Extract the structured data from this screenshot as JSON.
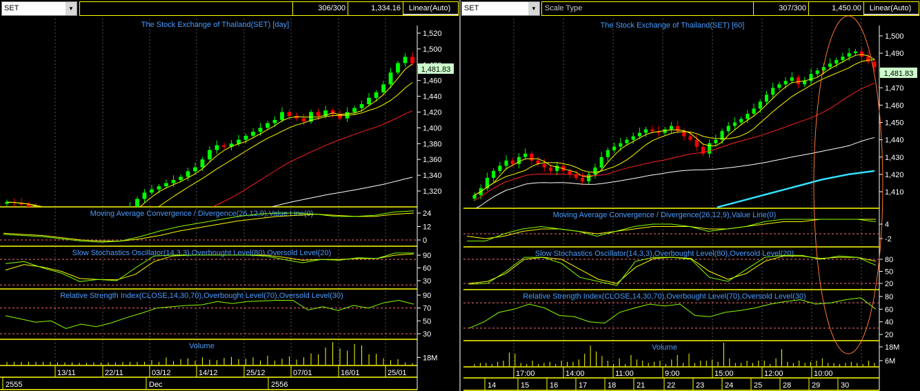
{
  "left": {
    "symbol": "SET",
    "count": "306/300",
    "value": "1,334.16",
    "scale": "Linear(Auto)",
    "scale_type_label": "",
    "title": "The Stock Exchange of Thailand(SET) [day]",
    "last_price": "1,481.83"
  },
  "right": {
    "symbol": "SET",
    "count": "307/300",
    "value": "1,450.00",
    "scale": "Linear(Auto)",
    "scale_type_label": "Scale Type",
    "title": "The Stock Exchange of Thailand(SET) [60]",
    "last_price": "1,481.83"
  },
  "colors": {
    "up": "#00ff00",
    "down": "#ff0000",
    "border": "#ffff00",
    "title": "#4a9cff",
    "ma_fast": "#ffff00",
    "ma_mid": "#ff2020",
    "ma_slow": "#ffffff",
    "ma_long": "#33e0ff",
    "level": "#ff7070",
    "annotation": "#ff7a30"
  },
  "chart_data": [
    {
      "type": "candlestick",
      "title": "The Stock Exchange of Thailand(SET) [day]",
      "ylim": [
        1310,
        1530
      ],
      "yticks": [
        "1,520",
        "1,500",
        "1,480",
        "1,460",
        "1,440",
        "1,420",
        "1,400",
        "1,380",
        "1,360",
        "1,340",
        "1,320"
      ],
      "xticks": [
        "13/11",
        "22/11",
        "03/12",
        "14/12",
        "25/12",
        "07/01",
        "16/01",
        "25/01"
      ],
      "periods": [
        "2555",
        "Dec",
        "2556"
      ],
      "close": [
        1306,
        1305,
        1303,
        1300,
        1295,
        1290,
        1285,
        1282,
        1280,
        1276,
        1272,
        1270,
        1268,
        1272,
        1278,
        1285,
        1292,
        1300,
        1310,
        1318,
        1322,
        1326,
        1330,
        1334,
        1338,
        1345,
        1350,
        1360,
        1372,
        1378,
        1376,
        1380,
        1385,
        1390,
        1395,
        1400,
        1406,
        1410,
        1420,
        1415,
        1412,
        1408,
        1420,
        1415,
        1422,
        1418,
        1412,
        1420,
        1425,
        1430,
        1438,
        1445,
        1455,
        1470,
        1482,
        1490,
        1481.83
      ],
      "volume": [
        8,
        8,
        8,
        8,
        8,
        8,
        8,
        7,
        7,
        7,
        6,
        6,
        7,
        7,
        7,
        7,
        8,
        8,
        8,
        8,
        12,
        8,
        18,
        10,
        14,
        16,
        11,
        18,
        13,
        12,
        17,
        19,
        14,
        15,
        18,
        11,
        22,
        11,
        15,
        20,
        13,
        18,
        27,
        25,
        40,
        52,
        38,
        33,
        48,
        45,
        25,
        26,
        16,
        12,
        14,
        7,
        5
      ],
      "volume_label": "Volume",
      "volume_ticks": [
        "18M"
      ],
      "macd": {
        "title": "Moving Average Convergence / Divergence(26,12,9),Value Line(0)",
        "ticks": [
          "24",
          "12",
          "0"
        ],
        "line": [
          5,
          4,
          3,
          1,
          -1,
          -2,
          -1,
          3,
          8,
          12,
          15,
          18,
          21,
          23,
          24,
          24,
          23,
          21,
          21,
          22,
          25,
          26
        ],
        "signal": [
          6,
          5,
          4,
          2,
          0,
          -1,
          -1,
          1,
          4,
          8,
          11,
          14,
          17,
          19,
          21,
          22,
          23,
          22,
          21,
          21,
          23,
          24
        ]
      },
      "stochastic": {
        "title": "Slow Stochastics Oscillator(14,3,3),Overbought Level(80),Oversold Level(20)",
        "ticks": [
          "90",
          "60",
          "30"
        ],
        "k": [
          70,
          75,
          60,
          48,
          28,
          33,
          30,
          60,
          88,
          90,
          90,
          90,
          90,
          90,
          88,
          80,
          72,
          80,
          78,
          84,
          82,
          95,
          95
        ],
        "d": [
          55,
          68,
          62,
          52,
          35,
          33,
          32,
          45,
          75,
          88,
          90,
          90,
          90,
          90,
          90,
          85,
          78,
          80,
          80,
          82,
          82,
          90,
          93
        ]
      },
      "rsi": {
        "title": "Relative Strength Index(CLOSE,14,30,70),Overbought Level(70),Oversold Level(30)",
        "ticks": [
          "90",
          "70",
          "50",
          "30"
        ],
        "values": [
          58,
          53,
          48,
          50,
          38,
          45,
          41,
          47,
          55,
          62,
          70,
          72,
          74,
          75,
          80,
          77,
          80,
          81,
          82,
          82,
          67,
          72,
          66,
          74,
          70,
          78,
          82,
          76
        ]
      }
    },
    {
      "type": "candlestick",
      "title": "The Stock Exchange of Thailand(SET) [60]",
      "ylim": [
        1403,
        1510
      ],
      "yticks": [
        "1,500",
        "1,490",
        "1,480",
        "1,470",
        "1,460",
        "1,450",
        "1,440",
        "1,430",
        "1,420",
        "1,410"
      ],
      "xticks": [
        "17:00",
        "14:00",
        "11:00",
        "9:00",
        "15:00",
        "12:00",
        "10:00"
      ],
      "periods": [
        "14",
        "15",
        "16",
        "17",
        "18",
        "21",
        "22",
        "23",
        "24",
        "25",
        "28",
        "29",
        "30"
      ],
      "close": [
        1408,
        1412,
        1418,
        1422,
        1425,
        1428,
        1426,
        1430,
        1432,
        1428,
        1426,
        1424,
        1422,
        1425,
        1422,
        1420,
        1418,
        1416,
        1420,
        1424,
        1430,
        1434,
        1436,
        1438,
        1440,
        1442,
        1444,
        1446,
        1445,
        1444,
        1446,
        1448,
        1445,
        1442,
        1440,
        1436,
        1432,
        1438,
        1440,
        1445,
        1448,
        1450,
        1452,
        1455,
        1458,
        1462,
        1466,
        1470,
        1472,
        1474,
        1476,
        1472,
        1474,
        1478,
        1480,
        1482,
        1484,
        1486,
        1488,
        1490,
        1491,
        1488,
        1485,
        1481.83
      ],
      "long_ma_tail": [
        1401,
        1405,
        1409,
        1413,
        1417,
        1420,
        1422
      ],
      "volume": [
        3,
        4,
        4,
        3,
        5,
        6,
        13,
        12,
        4,
        3,
        6,
        3,
        4,
        5,
        3,
        6,
        5,
        5,
        7,
        12,
        19,
        14,
        10,
        6,
        3,
        8,
        3,
        11,
        7,
        6,
        4,
        5,
        6,
        3,
        7,
        11,
        4,
        12,
        4,
        6,
        6,
        7,
        5,
        25,
        8,
        4,
        4,
        6,
        4,
        6,
        6,
        3,
        8,
        16,
        5,
        4,
        6,
        4,
        5,
        6,
        8,
        4,
        4,
        3,
        4,
        5,
        4,
        3,
        6,
        4
      ],
      "volume_label": "Volume",
      "volume_ticks": [
        "18M",
        "6M"
      ],
      "macd": {
        "title": "Moving Average Convergence / Divergence(26,12,9),Value Line(0)",
        "ticks": [
          "4",
          "-2"
        ],
        "line": [
          -3,
          -3,
          0,
          2,
          3,
          2,
          1,
          -1,
          1,
          3,
          4,
          4,
          3,
          1,
          2,
          3,
          5,
          6,
          6,
          6,
          6,
          6,
          5
        ],
        "signal": [
          -1,
          -2,
          -1,
          1,
          2,
          2,
          1,
          0,
          1,
          2,
          3,
          3,
          3,
          2,
          2,
          3,
          4,
          5,
          5,
          6,
          6,
          6,
          6
        ]
      },
      "stochastic": {
        "title": "Slow Stochastics Oscillator(14,3,3),Overbought Level(80),Oversold Level(20)",
        "ticks": [
          "80",
          "50",
          "20"
        ],
        "k": [
          18,
          20,
          50,
          85,
          85,
          70,
          35,
          25,
          15,
          75,
          85,
          85,
          80,
          35,
          25,
          55,
          85,
          90,
          90,
          80,
          88,
          85,
          65
        ],
        "d": [
          20,
          25,
          45,
          80,
          85,
          80,
          55,
          30,
          20,
          60,
          82,
          85,
          82,
          50,
          30,
          45,
          75,
          88,
          88,
          82,
          85,
          85,
          75
        ]
      },
      "rsi": {
        "title": "Relative Strength Index(CLOSE,14,30,70),Overbought Level(70),Oversold Level(30)",
        "ticks": [
          "80",
          "60",
          "40",
          "20"
        ],
        "values": [
          30,
          40,
          55,
          60,
          68,
          62,
          50,
          48,
          40,
          38,
          55,
          62,
          68,
          65,
          68,
          50,
          48,
          55,
          58,
          62,
          68,
          72,
          75,
          68,
          70,
          75,
          78,
          60
        ]
      }
    }
  ]
}
